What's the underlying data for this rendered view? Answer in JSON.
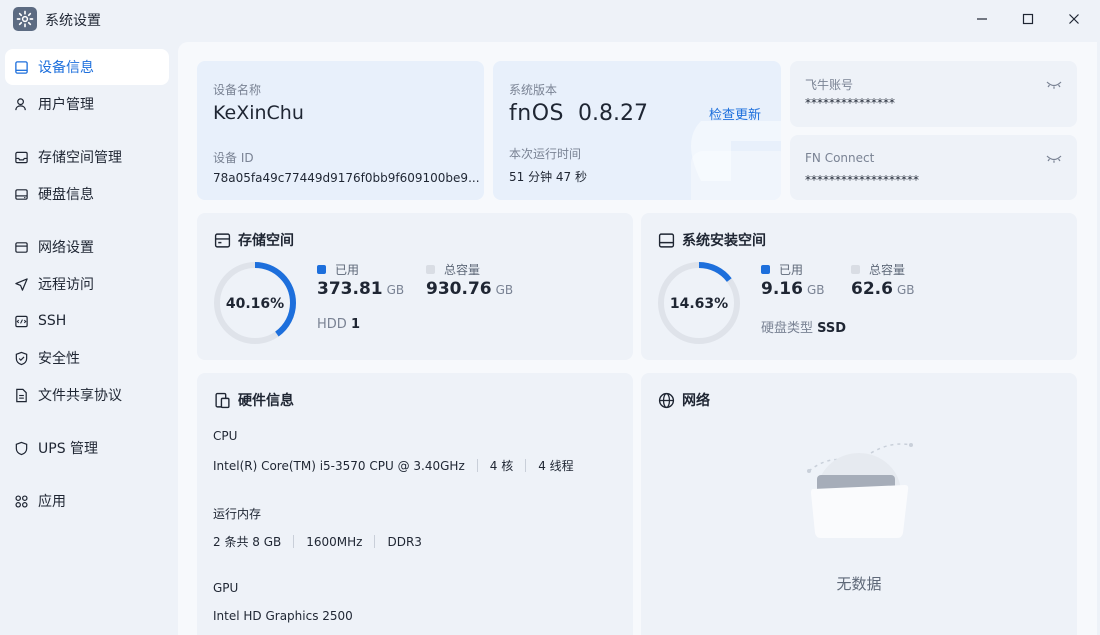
{
  "window": {
    "title": "系统设置"
  },
  "sidebar": {
    "items": [
      {
        "label": "设备信息",
        "icon": "device-info-icon",
        "active": true
      },
      {
        "label": "用户管理",
        "icon": "user-icon"
      },
      {
        "label": "存储空间管理",
        "icon": "storage-icon"
      },
      {
        "label": "硬盘信息",
        "icon": "disk-icon"
      },
      {
        "label": "网络设置",
        "icon": "network-settings-icon"
      },
      {
        "label": "远程访问",
        "icon": "remote-access-icon"
      },
      {
        "label": "SSH",
        "icon": "ssh-icon"
      },
      {
        "label": "安全性",
        "icon": "shield-icon"
      },
      {
        "label": "文件共享协议",
        "icon": "file-share-icon"
      },
      {
        "label": "UPS 管理",
        "icon": "ups-icon"
      },
      {
        "label": "应用",
        "icon": "apps-icon"
      }
    ]
  },
  "device": {
    "name_label": "设备名称",
    "name": "KeXinChu",
    "id_label": "设备 ID",
    "id": "78a05fa49c77449d9176f0bb9f609100be9..."
  },
  "system": {
    "version_label": "系统版本",
    "os": "fnOS",
    "version": "0.8.27",
    "check_update": "检查更新",
    "uptime_label": "本次运行时间",
    "uptime": "51 分钟 47 秒"
  },
  "accounts": {
    "feiniu_label": "飞牛账号",
    "feiniu_value": "***************",
    "fnconnect_label": "FN Connect",
    "fnconnect_value": "*******************"
  },
  "storage": {
    "title": "存储空间",
    "percent": "40.16%",
    "percent_value": 40.16,
    "used_label": "已用",
    "used": "373.81",
    "used_unit": "GB",
    "total_label": "总容量",
    "total": "930.76",
    "total_unit": "GB",
    "hdd_label": "HDD",
    "hdd_count": "1"
  },
  "system_space": {
    "title": "系统安装空间",
    "percent": "14.63%",
    "percent_value": 14.63,
    "used_label": "已用",
    "used": "9.16",
    "used_unit": "GB",
    "total_label": "总容量",
    "total": "62.6",
    "total_unit": "GB",
    "disk_type_label": "硬盘类型",
    "disk_type": "SSD"
  },
  "hardware": {
    "title": "硬件信息",
    "cpu_label": "CPU",
    "cpu_model": "Intel(R) Core(TM) i5-3570 CPU @ 3.40GHz",
    "cpu_cores": "4 核",
    "cpu_threads": "4 线程",
    "mem_label": "运行内存",
    "mem_size": "2 条共 8 GB",
    "mem_freq": "1600MHz",
    "mem_type": "DDR3",
    "gpu_label": "GPU",
    "gpu_model": "Intel HD Graphics 2500"
  },
  "network": {
    "title": "网络",
    "empty": "无数据"
  },
  "colors": {
    "accent": "#1d6fdc",
    "track": "#dfe3ea",
    "card": "#eef2f8"
  }
}
